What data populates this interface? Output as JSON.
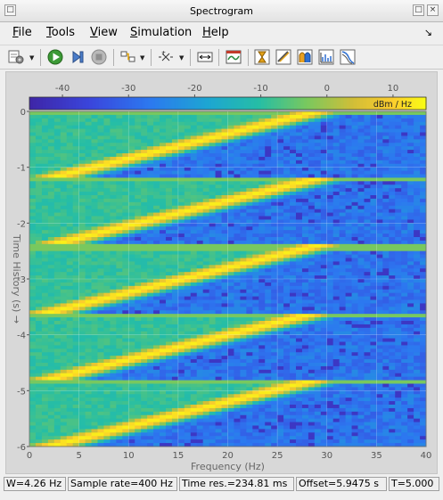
{
  "window": {
    "title": "Spectrogram",
    "dock_glyph": "↘"
  },
  "menu": [
    {
      "key": "F",
      "rest": "ile"
    },
    {
      "key": "T",
      "rest": "ools"
    },
    {
      "key": "V",
      "rest": "iew"
    },
    {
      "key": "S",
      "rest": "imulation"
    },
    {
      "key": "H",
      "rest": "elp"
    }
  ],
  "toolbar": {
    "icons": [
      "settings-icon",
      "run-icon",
      "step-forward-icon",
      "stop-icon",
      "highlight-signal-icon",
      "snapshot-icon",
      "scale-axes-icon",
      "maximize-axes-icon",
      "cursor-measurements-icon",
      "peak-finder-icon",
      "distortion-measurements-icon",
      "channel-measurements-icon",
      "ccdf-measurements-icon"
    ]
  },
  "colors": {
    "dark_blue": "#3e26a8",
    "blue": "#2d7dec",
    "cyan": "#1fb2c4",
    "green": "#86c558",
    "yellow": "#fcdc2f"
  },
  "colorbar": {
    "ticks": [
      "-40",
      "-30",
      "-20",
      "-10",
      "0",
      "10"
    ],
    "unit": "dBm / Hz"
  },
  "chart_data": {
    "type": "heatmap",
    "xlabel": "Frequency (Hz)",
    "ylabel": "Time History (s)  →",
    "xticks": [
      "0",
      "5",
      "10",
      "15",
      "20",
      "25",
      "30",
      "35",
      "40"
    ],
    "yticks": [
      "0",
      "-1",
      "-2",
      "-3",
      "-4",
      "-5",
      "-6"
    ],
    "xlim": [
      0,
      40
    ],
    "ylim": [
      -6,
      0
    ],
    "colorbar_range": [
      -45,
      15
    ],
    "colorbar_unit": "dBm / Hz",
    "signal": "linear chirp sweep, period ≈ 1.2 s, frequency rising from ~0 Hz to ~25 Hz within each period, noise floor ≈ -40 dBm/Hz"
  },
  "status": {
    "rbw": "W=4.26 Hz",
    "sample_rate": "Sample rate=400 Hz",
    "time_res": "Time res.=234.81 ms",
    "offset": "Offset=5.9475 s",
    "time": "T=5.000"
  }
}
